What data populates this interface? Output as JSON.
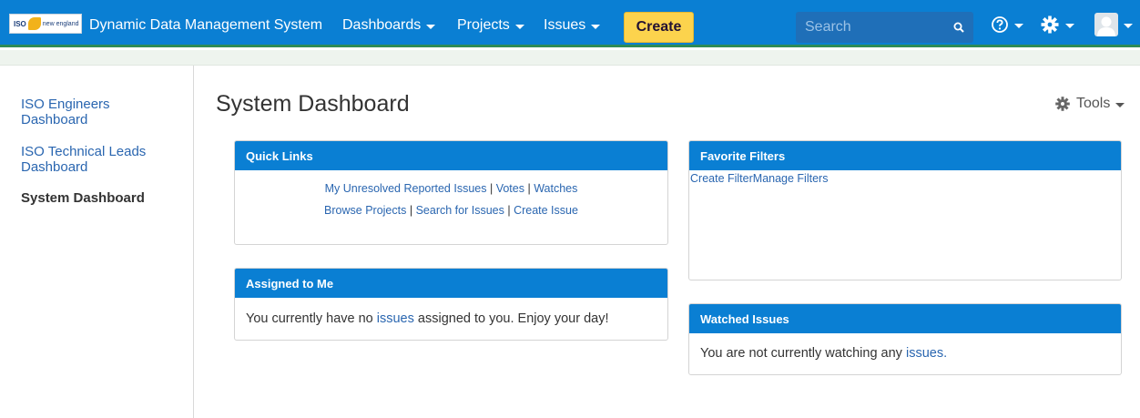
{
  "header": {
    "logo_text": "ISO",
    "logo_sub": "new england",
    "app_title": "Dynamic Data Management System",
    "nav": [
      "Dashboards",
      "Projects",
      "Issues"
    ],
    "create_label": "Create",
    "search_placeholder": "Search"
  },
  "sidebar": {
    "items": [
      {
        "label": "ISO Engineers Dashboard"
      },
      {
        "label": "ISO Technical Leads Dashboard"
      }
    ],
    "current": "System Dashboard"
  },
  "main": {
    "title": "System Dashboard",
    "tools_label": "Tools",
    "quick_links": {
      "header": "Quick Links",
      "row1": [
        "My Unresolved Reported Issues",
        "Votes",
        "Watches"
      ],
      "row2": [
        "Browse Projects",
        "Search for Issues",
        "Create Issue"
      ]
    },
    "assigned": {
      "header": "Assigned to Me",
      "text_before": "You currently have no ",
      "link": "issues",
      "text_after": " assigned to you. Enjoy your day!"
    },
    "favorites": {
      "header": "Favorite Filters",
      "link1": "Create Filter",
      "link2": "Manage Filters"
    },
    "watched": {
      "header": "Watched Issues",
      "text_before": "You are not currently watching any ",
      "link": "issues."
    }
  },
  "colors": {
    "nav_blue": "#0a7fd3",
    "create_yellow": "#fcd34d",
    "link_blue": "#2a66b0"
  }
}
